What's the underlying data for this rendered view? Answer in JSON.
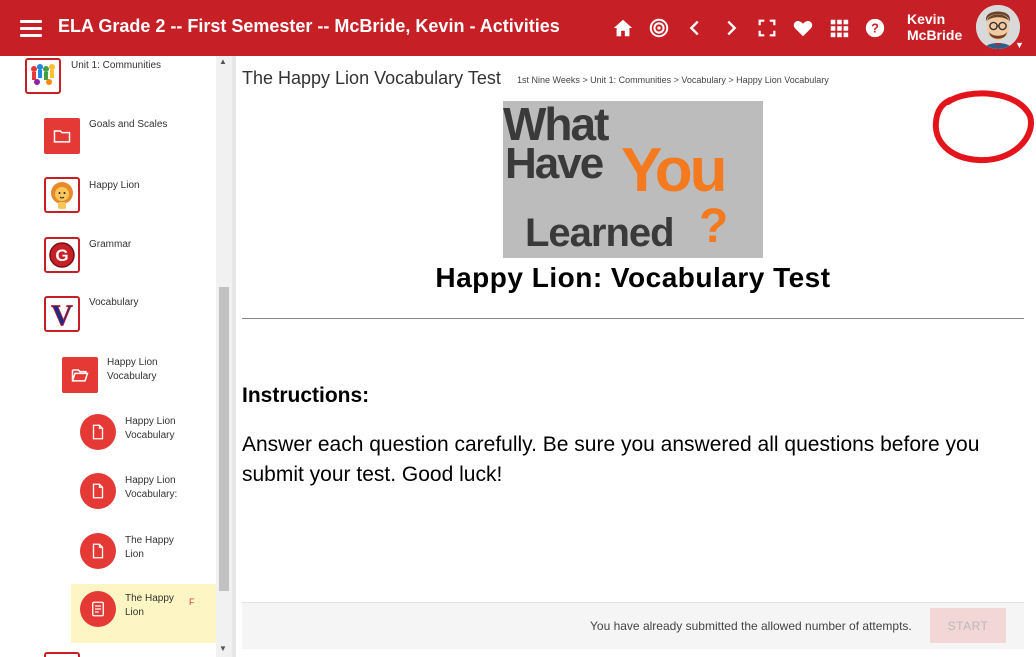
{
  "app": {
    "title": "ELA Grade 2 -- First Semester -- McBride, Kevin - Activities",
    "user_name": "Kevin McBride"
  },
  "toolbar": {
    "icons": [
      "menu-icon",
      "home-icon",
      "target-icon",
      "chevron-left-icon",
      "chevron-right-icon",
      "fullscreen-icon",
      "heart-icon",
      "apps-grid-icon",
      "help-icon"
    ]
  },
  "sidebar": {
    "items": [
      {
        "label": "Unit 1: Communities",
        "icon": "communities-image"
      },
      {
        "label": "Goals and Scales",
        "icon": "folder-icon"
      },
      {
        "label": "Happy Lion",
        "icon": "lion-image"
      },
      {
        "label": "Grammar",
        "icon": "grammar-g-image"
      },
      {
        "label": "Vocabulary",
        "icon": "vocabulary-v-image"
      },
      {
        "label": "Happy Lion Vocabulary",
        "icon": "folder-open-icon"
      },
      {
        "label": "Happy Lion Vocabulary",
        "icon": "document-icon"
      },
      {
        "label": "Happy Lion Vocabulary:",
        "icon": "document-icon"
      },
      {
        "label": "The Happy Lion",
        "icon": "document-icon"
      },
      {
        "label": "The Happy Lion",
        "icon": "test-icon",
        "flag": "F",
        "selected": true
      }
    ]
  },
  "main": {
    "page_title": "The Happy Lion Vocabulary Test",
    "breadcrumb": "1st Nine Weeks > Unit 1: Communities > Vocabulary > Happy Lion Vocabulary",
    "hero": {
      "line1": "What",
      "line2": "Have",
      "line3": "You",
      "line4": "Learned",
      "mark": "?"
    },
    "test_heading": "Happy Lion:  Vocabulary Test",
    "instructions_heading": "Instructions:",
    "instructions_body": "Answer each question carefully. Be sure you answered all questions before you submit your test. Good luck!"
  },
  "footer": {
    "message": "You have already submitted the allowed number of attempts.",
    "start_label": "START"
  },
  "colors": {
    "brand": "#c62026",
    "accent": "#e53935",
    "highlight": "#fdf6c4",
    "hero_orange": "#f47a20"
  }
}
